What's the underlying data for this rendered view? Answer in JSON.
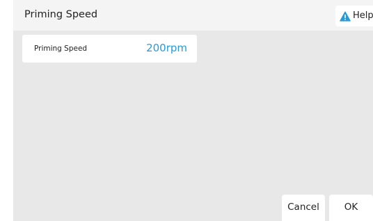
{
  "dialog": {
    "title": "Priming Speed",
    "help_label": "Help",
    "help_icon": "warning-triangle-icon",
    "accent_color": "#2a9ad6"
  },
  "settings": [
    {
      "label": "Priming Speed",
      "value": "200rpm"
    }
  ],
  "buttons": {
    "cancel_label": "Cancel",
    "ok_label": "OK"
  }
}
